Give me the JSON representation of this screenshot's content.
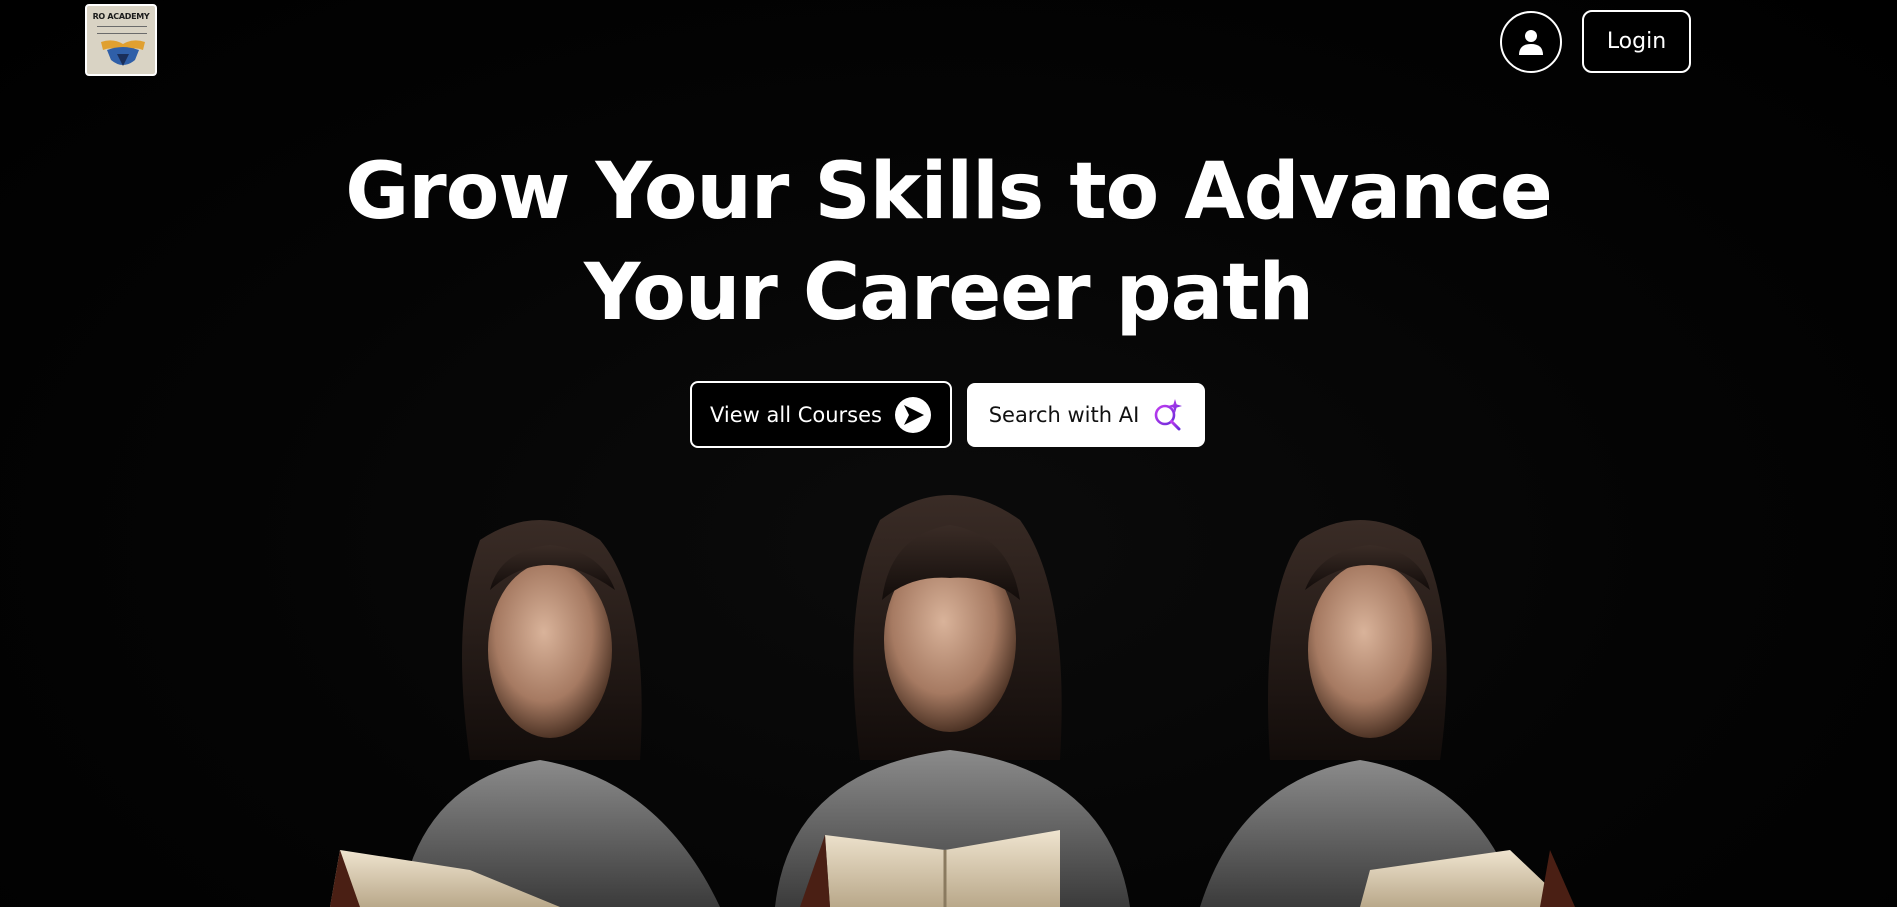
{
  "header": {
    "logo_text": "RO ACADEMY",
    "logo_icon": "academy-emblem-icon",
    "user_icon": "user-icon",
    "login_label": "Login"
  },
  "hero": {
    "title_line1": "Grow Your Skills to Advance",
    "title_line2": "Your Career path",
    "buttons": {
      "courses_label": "View all Courses",
      "courses_icon": "arrow-right-circle-icon",
      "ai_label": "Search with AI",
      "ai_icon": "ai-search-sparkle-icon"
    },
    "image_icon": "students-reading-image"
  },
  "colors": {
    "background": "#000000",
    "text": "#ffffff",
    "ai_accent": "#8a2be2"
  }
}
